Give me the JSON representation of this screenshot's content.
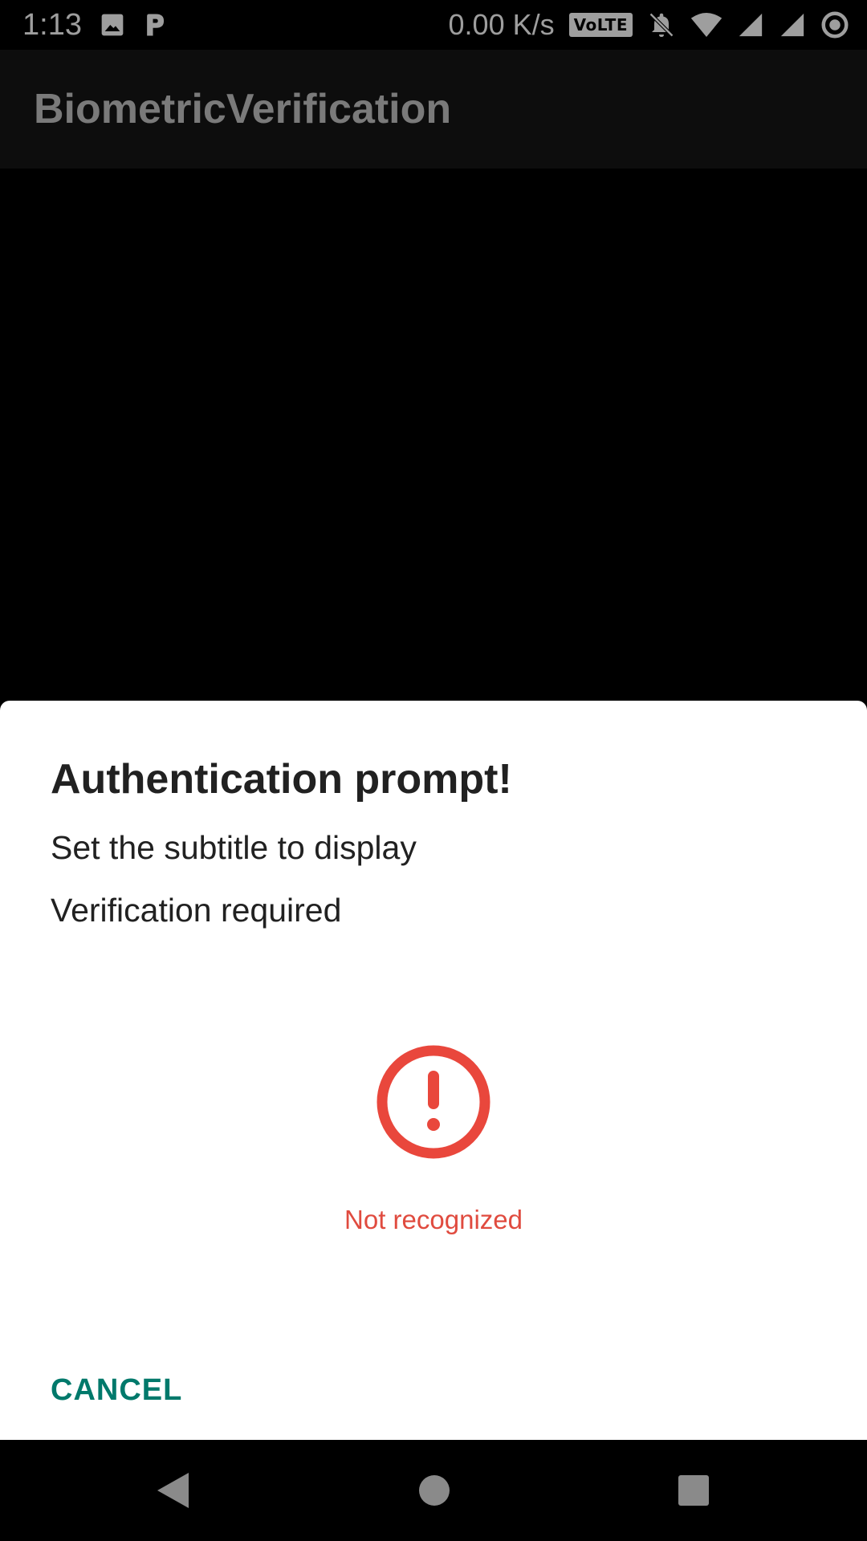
{
  "status_bar": {
    "time": "1:13",
    "network_speed": "0.00 K/s",
    "volte_label": "VoLTE",
    "icons": [
      "image-icon",
      "p-app-icon",
      "volte-icon",
      "bell-off-icon",
      "wifi-icon",
      "signal-icon",
      "signal-icon-2",
      "sync-ring-icon"
    ],
    "color": "#9e9e9e"
  },
  "app_bar": {
    "title": "BiometricVerification",
    "background": "#0d0d0d"
  },
  "dialog": {
    "title": "Authentication prompt!",
    "subtitle": "Set the subtitle to display",
    "description": "Verification required",
    "status_icon": "error-exclamation-icon",
    "status_text": "Not recognized",
    "cancel_label": "CANCEL",
    "error_color": "#e9473c",
    "accent_color": "#00796b"
  },
  "nav_bar": {
    "buttons": [
      "back-icon",
      "home-icon",
      "recents-icon"
    ]
  }
}
